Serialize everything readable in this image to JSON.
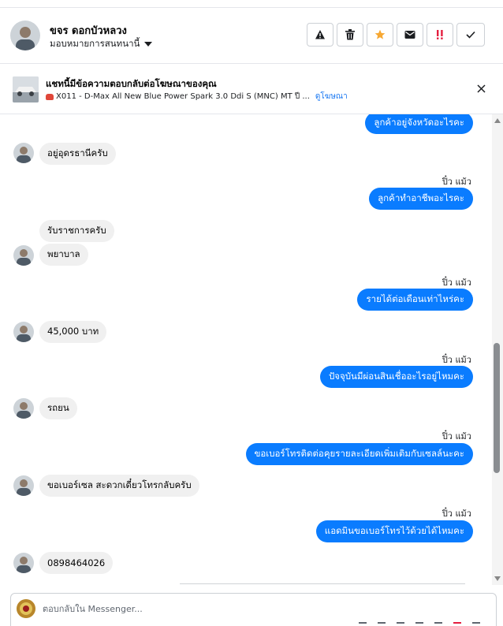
{
  "header": {
    "contact_name": "ขจร ดอกบัวหลวง",
    "assign_label": "มอบหมายการสนทนานี้",
    "actions": [
      {
        "name": "warning-icon",
        "color": "#1c1e21"
      },
      {
        "name": "trash-icon",
        "color": "#1c1e21"
      },
      {
        "name": "star-icon",
        "color": "#f7a833"
      },
      {
        "name": "mail-icon",
        "color": "#1c1e21"
      },
      {
        "name": "urgent-icon",
        "color": "#e41e3f"
      },
      {
        "name": "check-icon",
        "color": "#1c1e21"
      }
    ]
  },
  "ad_bar": {
    "title": "แชทนี้มีข้อความตอบกลับต่อโฆษณาของคุณ",
    "ad_text": "X011 - D-Max All New Blue Power Spark 3.0 Ddi S (MNC) MT ปี ...",
    "link_label": "ดูโฆษณา"
  },
  "messages": [
    {
      "dir": "out",
      "text": "ลูกค้าอยู่จังหวัดอะไรคะ"
    },
    {
      "dir": "in",
      "text": "อยู่อุดรธานีครับ"
    },
    {
      "dir": "out",
      "sender": "ปิ๋ว แม้ว",
      "text": "ลูกค้าทำอาชีพอะไรคะ"
    },
    {
      "dir": "in",
      "text": "รับราชการครับ"
    },
    {
      "dir": "in",
      "text": "พยาบาล"
    },
    {
      "dir": "out",
      "sender": "ปิ๋ว แม้ว",
      "text": "รายได้ต่อเดือนเท่าไหร่คะ"
    },
    {
      "dir": "in",
      "text": "45,000 บาท"
    },
    {
      "dir": "out",
      "sender": "ปิ๋ว แม้ว",
      "text": "ปัจจุบันมีผ่อนสินเชื่ออะไรอยู่ไหมคะ"
    },
    {
      "dir": "in",
      "text": "รถยน"
    },
    {
      "dir": "out",
      "sender": "ปิ๋ว แม้ว",
      "text": "ขอเบอร์โทรติดต่อคุยรายละเอียดเพิ่มเติมกับเซลล์นะคะ"
    },
    {
      "dir": "in",
      "text": "ขอเบอร์เซล  สะดวกเดี๋ยวโทรกลับครับ"
    },
    {
      "dir": "out",
      "sender": "ปิ๋ว แม้ว",
      "text": "แอดมินขอเบอร์โทรไว้ด้วยได้ไหมคะ"
    },
    {
      "dir": "in",
      "text": "0898464026"
    }
  ],
  "composer": {
    "placeholder": "ตอบกลับใน Messenger..."
  },
  "colors": {
    "outgoing_bubble": "#0a7cff",
    "incoming_bubble": "#f0f0f0",
    "link": "#1877f2"
  }
}
